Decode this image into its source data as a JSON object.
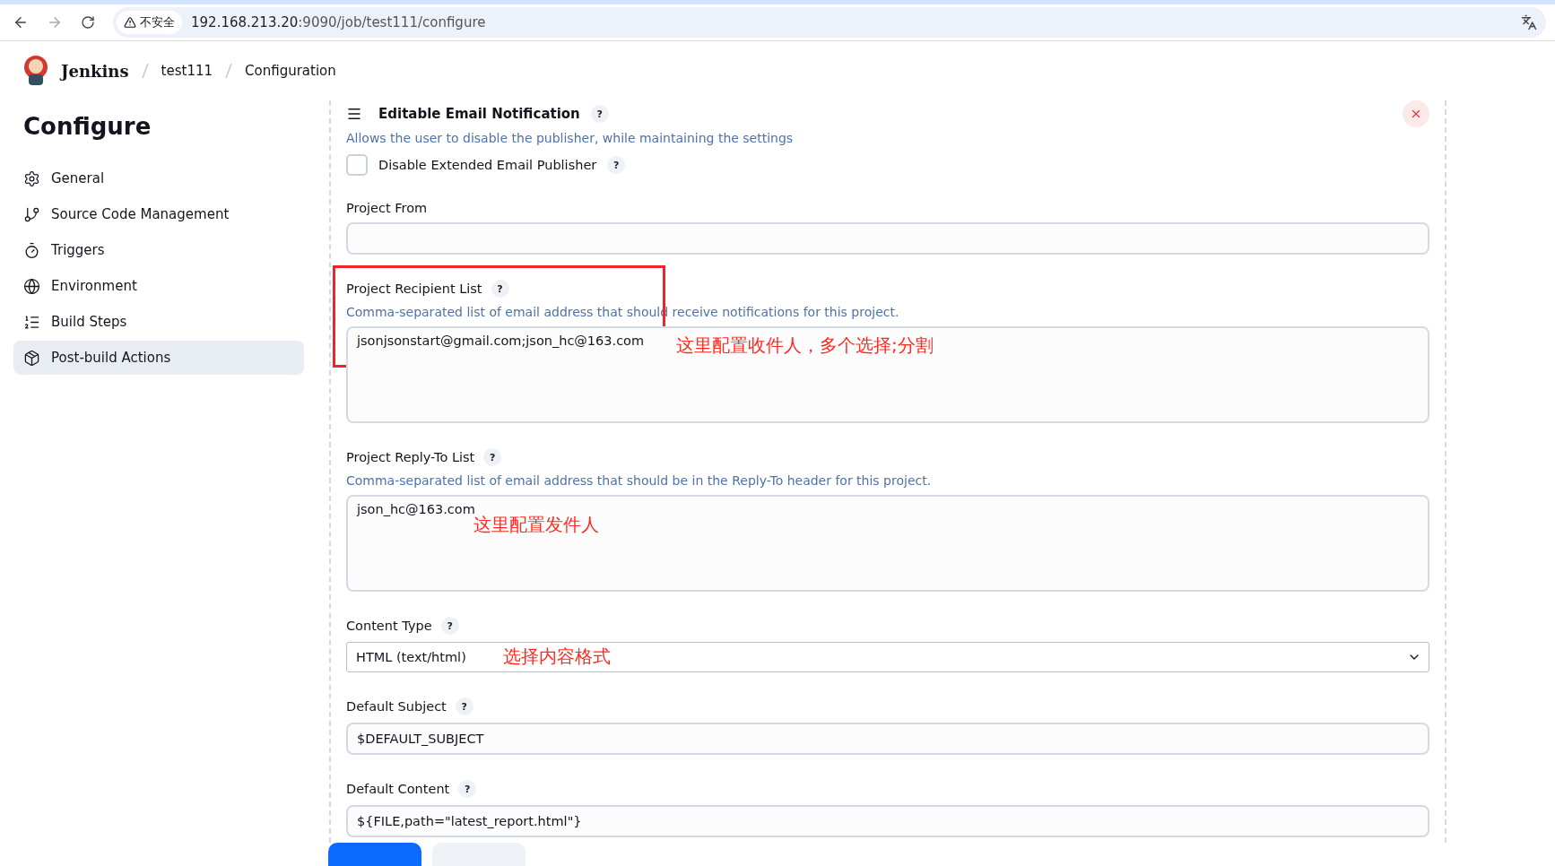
{
  "browser": {
    "security_label": "不安全",
    "url_host": "192.168.213.20",
    "url_rest": ":9090/job/test111/configure"
  },
  "header": {
    "logo_text": "Jenkins",
    "breadcrumbs": [
      "test111",
      "Configuration"
    ]
  },
  "sidebar": {
    "title": "Configure",
    "items": [
      {
        "label": "General",
        "selected": false
      },
      {
        "label": "Source Code Management",
        "selected": false
      },
      {
        "label": "Triggers",
        "selected": false
      },
      {
        "label": "Environment",
        "selected": false
      },
      {
        "label": "Build Steps",
        "selected": false
      },
      {
        "label": "Post-build Actions",
        "selected": true
      }
    ]
  },
  "section": {
    "title": "Editable Email Notification",
    "help": "?",
    "description": "Allows the user to disable the publisher, while maintaining the settings",
    "fields": [
      {
        "kind": "checkbox",
        "label": "Disable Extended Email Publisher",
        "help": "?",
        "checked": false
      },
      {
        "kind": "text",
        "label": "Project From"
      },
      {
        "kind": "textarea",
        "label": "Project Recipient List",
        "help": "?",
        "description": "Comma-separated list of email address that should receive notifications for this project.",
        "value": "jsonjsonstart@gmail.com;json_hc@163.com",
        "annotation": "这里配置收件人，多个选择;分割",
        "highlighted": true
      },
      {
        "kind": "textarea",
        "label": "Project Reply-To List",
        "help": "?",
        "description": "Comma-separated list of email address that should be in the Reply-To header for this project.",
        "value": "json_hc@163.com",
        "annotation": "这里配置发件人"
      },
      {
        "kind": "select",
        "label": "Content Type",
        "help": "?",
        "value": "HTML (text/html)",
        "annotation": "选择内容格式"
      },
      {
        "kind": "text",
        "label": "Default Subject",
        "help": "?",
        "value": "$DEFAULT_SUBJECT"
      },
      {
        "kind": "text",
        "label": "Default Content",
        "help": "?",
        "value": "${FILE,path=\"latest_report.html\"}"
      }
    ]
  }
}
